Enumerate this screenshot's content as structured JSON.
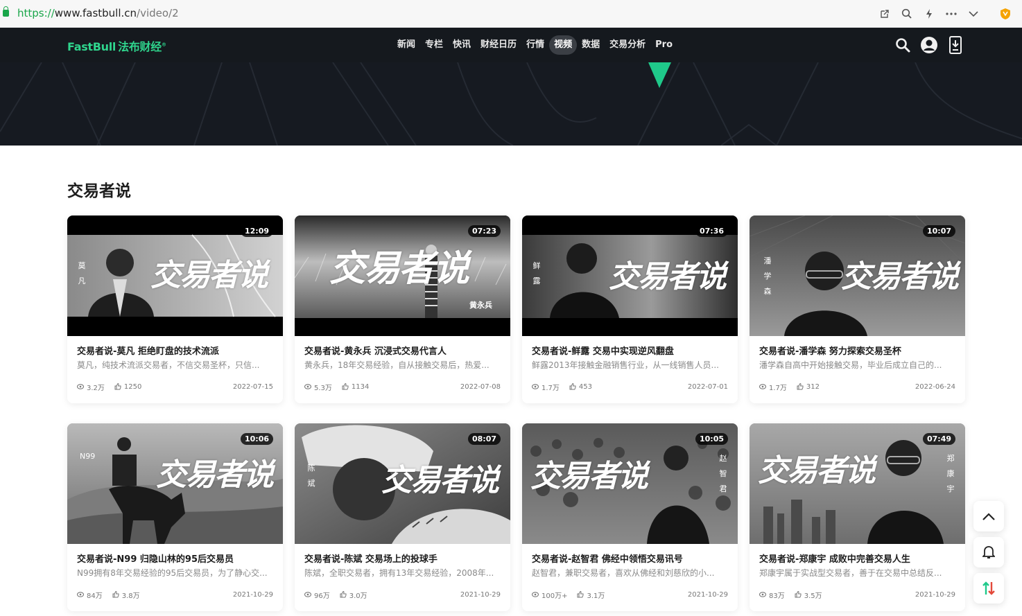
{
  "browser": {
    "url_proto": "https://",
    "url_host": "www.fastbull.cn",
    "url_path": "/video/2"
  },
  "header": {
    "logo_en": "FastBull",
    "logo_cn": "法布财经",
    "logo_mark": "®",
    "nav": [
      {
        "label": "新闻"
      },
      {
        "label": "专栏"
      },
      {
        "label": "快讯"
      },
      {
        "label": "财经日历"
      },
      {
        "label": "行情"
      },
      {
        "label": "视频",
        "active": true
      },
      {
        "label": "数据"
      },
      {
        "label": "交易分析"
      },
      {
        "label": "Pro"
      }
    ]
  },
  "section": {
    "title": "交易者说"
  },
  "thumb_logo_text": "交易者说",
  "cards": [
    {
      "duration": "12:09",
      "name": "莫凡",
      "title": "交易者说-莫凡 拒绝盯盘的技术流派",
      "desc": "莫凡，纯技术流派交易者，不信交易圣杯，只信...",
      "views": "3.2万",
      "likes": "1250",
      "date": "2022-07-15"
    },
    {
      "duration": "07:23",
      "name": "黄永兵",
      "title": "交易者说-黄永兵 沉浸式交易代言人",
      "desc": "黄永兵，18年交易经验，自从接触交易后，热爱...",
      "views": "5.3万",
      "likes": "1134",
      "date": "2022-07-08"
    },
    {
      "duration": "07:36",
      "name": "鲜露",
      "title": "交易者说-鲜露 交易中实现逆风翻盘",
      "desc": "鲜露2013年接触金融销售行业，从一线销售人员...",
      "views": "1.7万",
      "likes": "453",
      "date": "2022-07-01"
    },
    {
      "duration": "10:07",
      "name": "潘学森",
      "title": "交易者说-潘学森 努力探索交易圣杯",
      "desc": "潘学森自高中开始接触交易，毕业后成立自己的...",
      "views": "1.7万",
      "likes": "312",
      "date": "2022-06-24"
    },
    {
      "duration": "10:06",
      "name": "N99",
      "title": "交易者说-N99 归隐山林的95后交易员",
      "desc": "N99拥有8年交易经验的95后交易员，为了静心交...",
      "views": "84万",
      "likes": "3.8万",
      "date": "2021-10-29"
    },
    {
      "duration": "08:07",
      "name": "陈斌",
      "title": "交易者说-陈斌 交易场上的投球手",
      "desc": "陈斌，全职交易者，拥有13年交易经验，2008年...",
      "views": "96万",
      "likes": "3.0万",
      "date": "2021-10-29"
    },
    {
      "duration": "10:05",
      "name": "赵智君",
      "title": "交易者说-赵智君 佛经中领悟交易讯号",
      "desc": "赵智君，兼职交易者，喜欢从佛经和刘慈欣的小...",
      "views": "100万+",
      "likes": "3.1万",
      "date": "2021-10-29"
    },
    {
      "duration": "07:49",
      "name": "郑康宇",
      "title": "交易者说-郑康宇 成败中完善交易人生",
      "desc": "郑康宇属于实战型交易者，善于在交易中总结反...",
      "views": "83万",
      "likes": "3.5万",
      "date": "2021-10-29"
    }
  ],
  "colors": {
    "brand": "#2fd58d",
    "header_bg": "#15191e",
    "banner_accent": "#1fc98a"
  }
}
